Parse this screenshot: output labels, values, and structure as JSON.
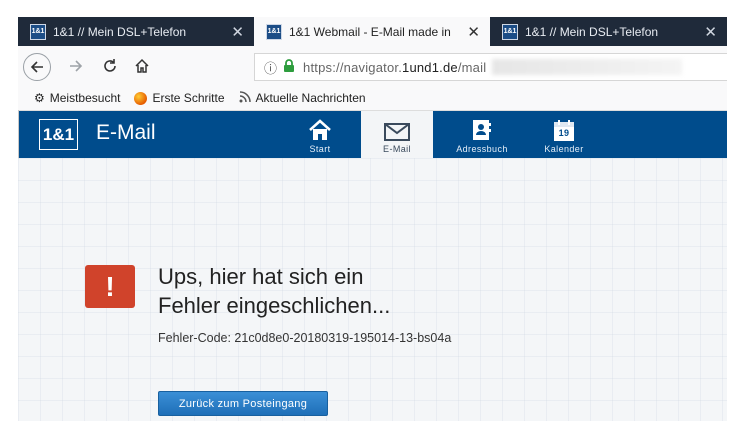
{
  "tabs": [
    {
      "favicon": "1&1",
      "title": "1&1 // Mein DSL+Telefon",
      "close": "✕",
      "active": false
    },
    {
      "favicon": "1&1",
      "title": "1&1 Webmail - E-Mail made in",
      "close": "✕",
      "active": true
    },
    {
      "favicon": "1&1",
      "title": "1&1 // Mein DSL+Telefon",
      "close": "✕",
      "active": false
    }
  ],
  "navbar": {
    "url_prefix": "https://navigator.",
    "url_domain": "1und1.de",
    "url_suffix": "/mail"
  },
  "bookmarks": [
    {
      "icon": "gear-icon",
      "label": "Meistbesucht"
    },
    {
      "icon": "firefox-icon",
      "label": "Erste Schritte"
    },
    {
      "icon": "rss-icon",
      "label": "Aktuelle Nachrichten"
    }
  ],
  "app": {
    "logo": "1&1",
    "title": "E-Mail",
    "nav": [
      {
        "icon": "home-icon",
        "label": "Start"
      },
      {
        "icon": "envelope-icon",
        "label": "E-Mail",
        "active": true
      },
      {
        "icon": "contacts-icon",
        "label": "Adressbuch"
      },
      {
        "icon": "calendar-icon",
        "label": "Kalender",
        "calendar_day": "19"
      }
    ]
  },
  "error": {
    "icon_glyph": "!",
    "headline_line1": "Ups, hier hat sich ein",
    "headline_line2": "Fehler eingeschlichen...",
    "code_text": "Fehler-Code: 21c0d8e0-20180319-195014-13-bs04a",
    "button_label": "Zurück zum Posteingang"
  },
  "colors": {
    "brand_blue": "#004c8c",
    "error_red": "#d0432b",
    "button_blue": "#2a7cc7"
  }
}
